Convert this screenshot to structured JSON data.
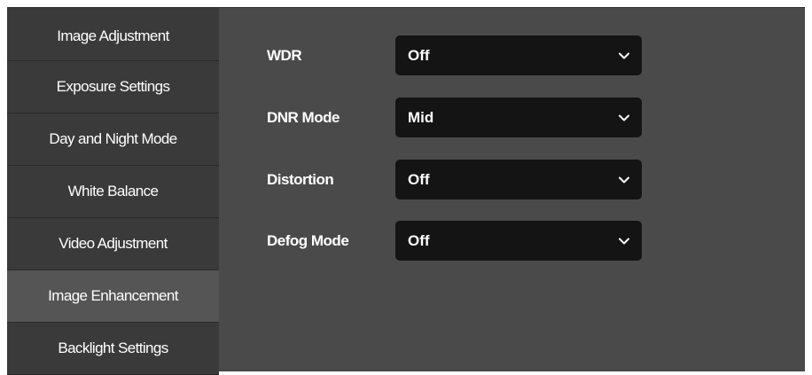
{
  "sidebar": {
    "items": [
      {
        "label": "Image Adjustment"
      },
      {
        "label": "Exposure Settings"
      },
      {
        "label": "Day and Night Mode"
      },
      {
        "label": "White Balance"
      },
      {
        "label": "Video Adjustment"
      },
      {
        "label": "Image Enhancement",
        "active": true
      },
      {
        "label": "Backlight Settings"
      }
    ]
  },
  "settings": {
    "wdr": {
      "label": "WDR",
      "value": "Off"
    },
    "dnr_mode": {
      "label": "DNR Mode",
      "value": "Mid"
    },
    "distortion": {
      "label": "Distortion",
      "value": "Off"
    },
    "defog_mode": {
      "label": "Defog Mode",
      "value": "Off"
    }
  },
  "icons": {
    "dropdown": "chevron-down-icon"
  },
  "colors": {
    "sidebar_bg": "#3a3a3a",
    "active_item_bg": "#555555",
    "main_bg": "#4a4a4a",
    "select_bg": "#141414"
  }
}
